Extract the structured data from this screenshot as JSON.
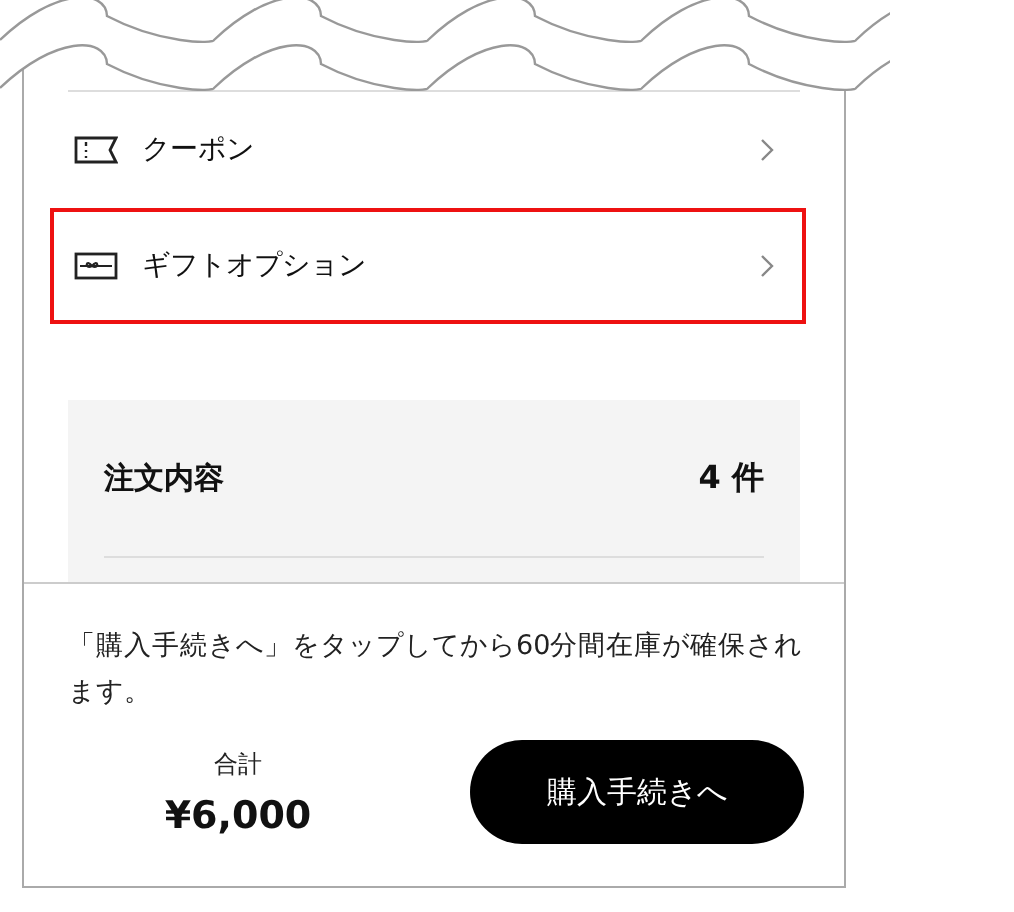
{
  "menu_items": [
    {
      "kind": "coupon",
      "label": "クーポン",
      "highlighted": false
    },
    {
      "kind": "gift",
      "label": "ギフトオプション",
      "highlighted": true
    }
  ],
  "order_summary": {
    "title": "注文内容",
    "count": "4 件"
  },
  "notice": "「購入手続きへ」をタップしてから60分間在庫が確保されます。",
  "total": {
    "label": "合計",
    "amount": "¥6,000"
  },
  "checkout_button": "購入手続きへ"
}
